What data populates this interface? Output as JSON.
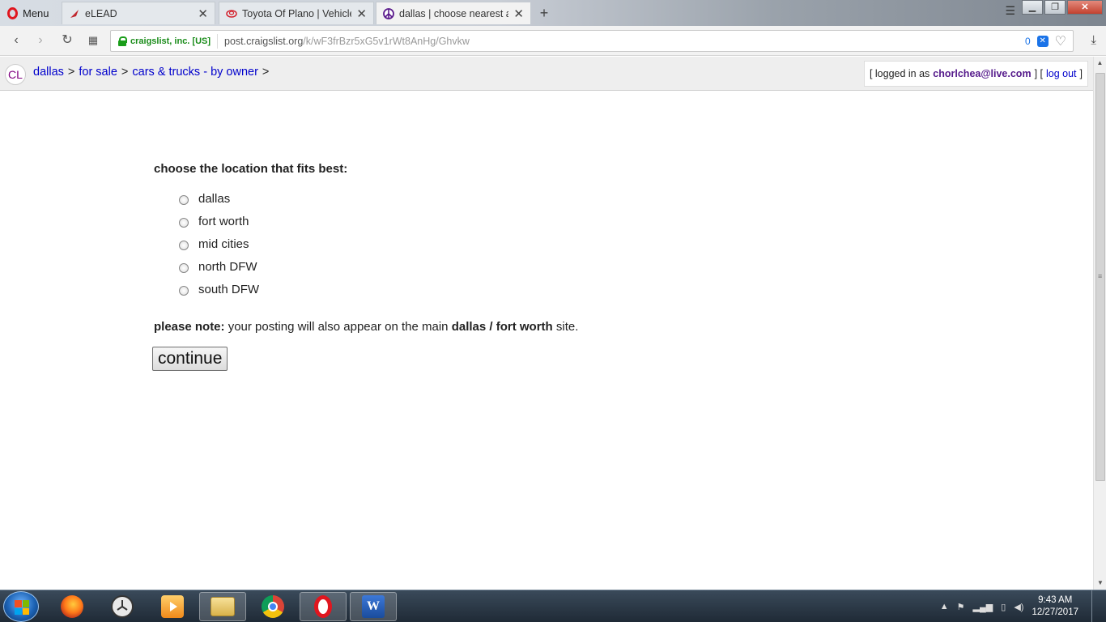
{
  "browser": {
    "menu_label": "Menu",
    "tabs": [
      {
        "title": "eLEAD",
        "favicon": "elead-icon"
      },
      {
        "title": "Toyota Of Plano | Vehicles",
        "favicon": "toyota-icon"
      },
      {
        "title": "dallas | choose nearest are",
        "favicon": "peace-icon",
        "active": true
      }
    ],
    "new_tab": "+",
    "address": {
      "secure_label": "craigslist, inc. [US]",
      "host": "post.craigslist.org",
      "path": "/k/wF3frBzr5xG5v1rWt8AnHg/Ghvkw",
      "blocked_count": "0"
    }
  },
  "header": {
    "logo": "CL",
    "breadcrumbs": [
      "dallas",
      "for sale",
      "cars & trucks - by owner"
    ],
    "separator": ">",
    "user": {
      "prefix": "[ logged in as",
      "email": "chorlchea@live.com",
      "mid": "] [",
      "logout": "log out",
      "suffix": "]"
    }
  },
  "form": {
    "prompt": "choose the location that fits best:",
    "options": [
      "dallas",
      "fort worth",
      "mid cities",
      "north DFW",
      "south DFW"
    ],
    "note_label": "please note:",
    "note_text": "your posting will also appear on the main",
    "note_site": "dallas / fort worth",
    "note_end": "site.",
    "continue_label": "continue"
  },
  "taskbar": {
    "time": "9:43 AM",
    "date": "12/27/2017",
    "apps": [
      "firefox-icon",
      "clock-app-icon",
      "media-player-icon",
      "file-explorer-icon",
      "chrome-icon",
      "opera-icon",
      "word-icon"
    ]
  },
  "colors": {
    "link": "#0000cc",
    "visited": "#551a8b",
    "secure": "#1a8c1a",
    "header_bg": "#eeeeee"
  }
}
